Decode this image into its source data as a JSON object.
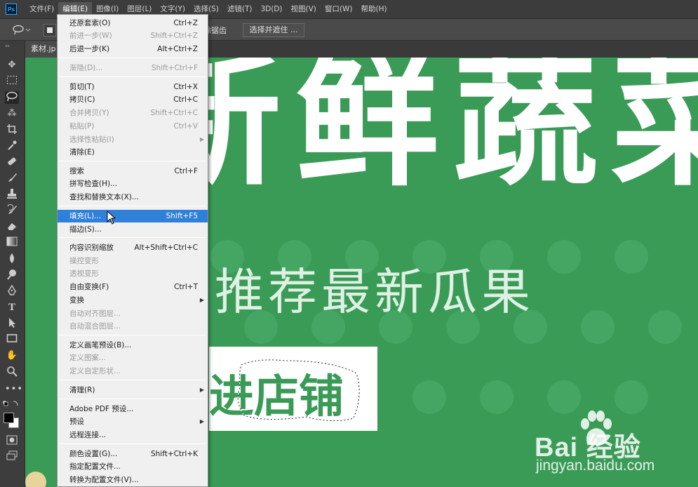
{
  "app": {
    "logo_text": "Ps"
  },
  "menubar": {
    "items": [
      "文件(F)",
      "编辑(E)",
      "图像(I)",
      "图层(L)",
      "文字(Y)",
      "选择(S)",
      "滤镜(T)",
      "3D(D)",
      "视图(V)",
      "窗口(W)",
      "帮助(H)"
    ]
  },
  "options": {
    "partial_label": "除锯齿",
    "select_mask_button": "选择并遮住 ..."
  },
  "document": {
    "tab_label": "素材.jp"
  },
  "edit_menu": {
    "items": [
      {
        "label": "还原套索(O)",
        "shortcut": "Ctrl+Z",
        "state": "enabled"
      },
      {
        "label": "前进一步(W)",
        "shortcut": "Shift+Ctrl+Z",
        "state": "disabled"
      },
      {
        "label": "后退一步(K)",
        "shortcut": "Alt+Ctrl+Z",
        "state": "enabled"
      },
      {
        "label": "渐隐(D)...",
        "shortcut": "Shift+Ctrl+F",
        "state": "disabled"
      },
      {
        "label": "剪切(T)",
        "shortcut": "Ctrl+X",
        "state": "enabled"
      },
      {
        "label": "拷贝(C)",
        "shortcut": "Ctrl+C",
        "state": "enabled"
      },
      {
        "label": "合并拷贝(Y)",
        "shortcut": "Shift+Ctrl+C",
        "state": "disabled"
      },
      {
        "label": "粘贴(P)",
        "shortcut": "Ctrl+V",
        "state": "disabled"
      },
      {
        "label": "选择性粘贴(I)",
        "shortcut": "",
        "state": "disabled",
        "submenu": true
      },
      {
        "label": "清除(E)",
        "shortcut": "",
        "state": "enabled"
      },
      {
        "label": "搜索",
        "shortcut": "Ctrl+F",
        "state": "enabled"
      },
      {
        "label": "拼写检查(H)...",
        "shortcut": "",
        "state": "enabled"
      },
      {
        "label": "查找和替换文本(X)...",
        "shortcut": "",
        "state": "enabled"
      },
      {
        "label": "填充(L)...",
        "shortcut": "Shift+F5",
        "state": "highlighted"
      },
      {
        "label": "描边(S)...",
        "shortcut": "",
        "state": "enabled"
      },
      {
        "label": "内容识别缩放",
        "shortcut": "Alt+Shift+Ctrl+C",
        "state": "enabled"
      },
      {
        "label": "操控变形",
        "shortcut": "",
        "state": "disabled"
      },
      {
        "label": "透视变形",
        "shortcut": "",
        "state": "disabled"
      },
      {
        "label": "自由变换(F)",
        "shortcut": "Ctrl+T",
        "state": "enabled"
      },
      {
        "label": "变换",
        "shortcut": "",
        "state": "enabled",
        "submenu": true
      },
      {
        "label": "自动对齐图层...",
        "shortcut": "",
        "state": "disabled"
      },
      {
        "label": "自动混合图层...",
        "shortcut": "",
        "state": "disabled"
      },
      {
        "label": "定义画笔预设(B)...",
        "shortcut": "",
        "state": "enabled"
      },
      {
        "label": "定义图案...",
        "shortcut": "",
        "state": "disabled"
      },
      {
        "label": "定义自定形状...",
        "shortcut": "",
        "state": "disabled"
      },
      {
        "label": "清理(R)",
        "shortcut": "",
        "state": "enabled",
        "submenu": true
      },
      {
        "label": "Adobe PDF 预设...",
        "shortcut": "",
        "state": "enabled"
      },
      {
        "label": "预设",
        "shortcut": "",
        "state": "enabled",
        "submenu": true
      },
      {
        "label": "远程连接...",
        "shortcut": "",
        "state": "enabled"
      },
      {
        "label": "颜色设置(G)...",
        "shortcut": "Shift+Ctrl+K",
        "state": "enabled"
      },
      {
        "label": "指定配置文件...",
        "shortcut": "",
        "state": "enabled"
      },
      {
        "label": "转换为配置文件(V)...",
        "shortcut": "",
        "state": "enabled"
      }
    ]
  },
  "canvas": {
    "title_text": "新鲜蔬菜",
    "subtitle_text": "推荐最新瓜果",
    "button_text": "进店铺",
    "background_color": "#3a9b57"
  },
  "watermark": {
    "brand": "Bai  经验",
    "url": "jingyan.baidu.com"
  },
  "colors": {
    "foreground": "#000000",
    "background": "#ffffff",
    "menu_highlight": "#2f80d8",
    "annotation_arrow": "#e03030"
  },
  "toolbar": {
    "tools": [
      "move-icon",
      "marquee-icon",
      "lasso-icon",
      "magic-wand-icon",
      "crop-icon",
      "eyedropper-icon",
      "healing-icon",
      "brush-icon",
      "stamp-icon",
      "history-brush-icon",
      "eraser-icon",
      "gradient-icon",
      "blur-icon",
      "dodge-icon",
      "pen-icon",
      "type-icon",
      "path-select-icon",
      "shape-icon",
      "hand-icon",
      "zoom-icon",
      "more-icon"
    ]
  }
}
